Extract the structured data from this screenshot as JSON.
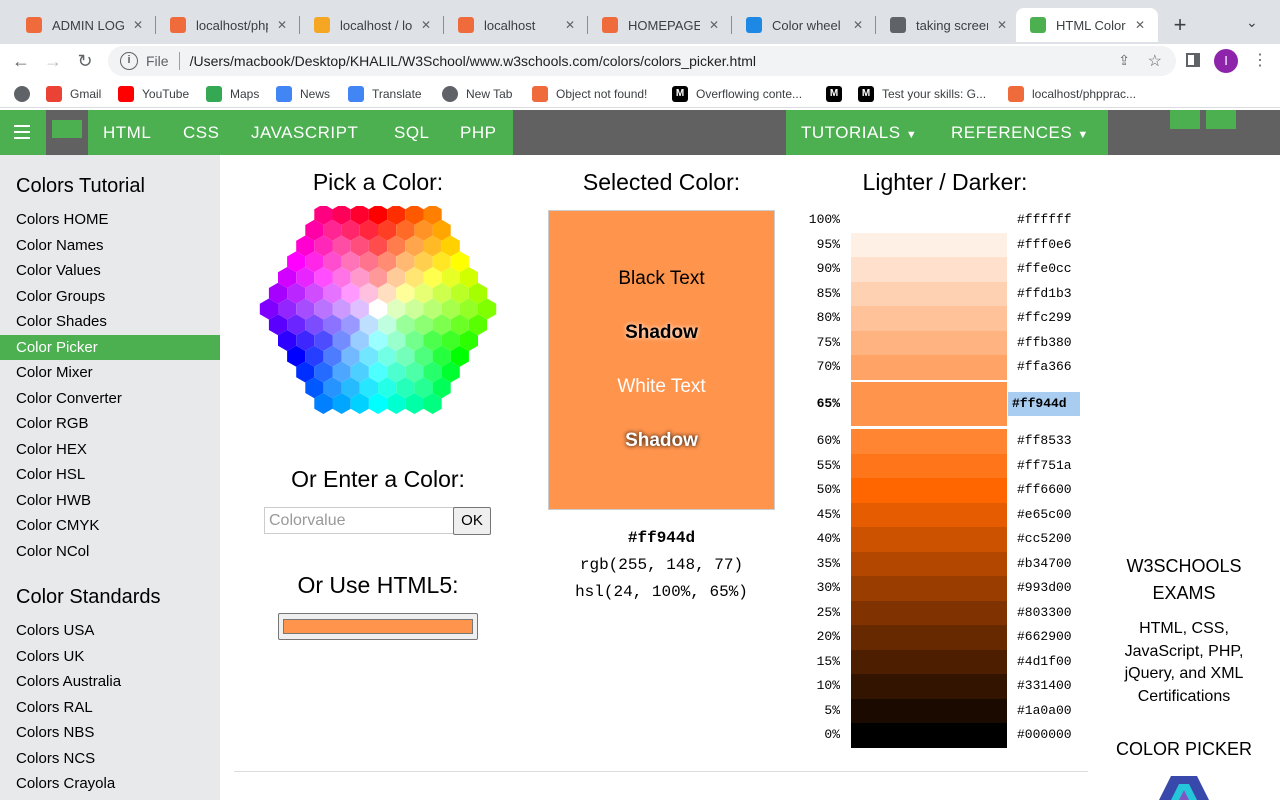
{
  "browser": {
    "tabs": [
      {
        "title": "ADMIN LOGIN",
        "icon": "xampp-icon",
        "color": "#f06b3c"
      },
      {
        "title": "localhost/phpp",
        "icon": "xampp-icon",
        "color": "#f06b3c"
      },
      {
        "title": "localhost / loc",
        "icon": "phpmyadmin-icon",
        "color": "#f5a623"
      },
      {
        "title": "localhost",
        "icon": "xampp-icon",
        "color": "#f06b3c"
      },
      {
        "title": "HOMEPAGE",
        "icon": "xampp-icon",
        "color": "#f06b3c"
      },
      {
        "title": "Color wheel -",
        "icon": "canva-icon",
        "color": "#1e88e5"
      },
      {
        "title": "taking screens",
        "icon": "globe-icon",
        "color": "#5f6368"
      },
      {
        "title": "HTML Color P",
        "icon": "w3schools-icon",
        "color": "#4caf50"
      }
    ],
    "address": {
      "scheme": "File",
      "url": "/Users/macbook/Desktop/KHALIL/W3School/www.w3schools.com/colors/colors_picker.html"
    },
    "profile_initial": "I",
    "bookmarks": [
      {
        "label": "",
        "icon": "apps-grid-icon"
      },
      {
        "label": "Gmail",
        "icon": "gmail-icon"
      },
      {
        "label": "YouTube",
        "icon": "youtube-icon"
      },
      {
        "label": "Maps",
        "icon": "maps-icon"
      },
      {
        "label": "News",
        "icon": "news-icon"
      },
      {
        "label": "Translate",
        "icon": "translate-icon"
      },
      {
        "label": "New Tab",
        "icon": "globe-icon"
      },
      {
        "label": "Object not found!",
        "icon": "xampp-icon"
      },
      {
        "label": "Overflowing conte...",
        "icon": "medium-icon"
      },
      {
        "label": "",
        "icon": "medium-icon"
      },
      {
        "label": "Test your skills: G...",
        "icon": "medium-icon"
      },
      {
        "label": "localhost/phpprac...",
        "icon": "xampp-icon"
      }
    ]
  },
  "topnav": {
    "left": [
      "HTML",
      "CSS",
      "JAVASCRIPT",
      "SQL",
      "PHP"
    ],
    "right": [
      "TUTORIALS",
      "REFERENCES"
    ]
  },
  "sidebar": {
    "heading1": "Colors Tutorial",
    "items1": [
      "Colors HOME",
      "Color Names",
      "Color Values",
      "Color Groups",
      "Color Shades",
      "Color Picker",
      "Color Mixer",
      "Color Converter",
      "Color RGB",
      "Color HEX",
      "Color HSL",
      "Color HWB",
      "Color CMYK",
      "Color NCol"
    ],
    "active": "Color Picker",
    "heading2": "Color Standards",
    "items2": [
      "Colors USA",
      "Colors UK",
      "Colors Australia",
      "Colors RAL",
      "Colors NBS",
      "Colors NCS",
      "Colors Crayola"
    ]
  },
  "main": {
    "pick_heading": "Pick a Color:",
    "enter_heading": "Or Enter a Color:",
    "input_placeholder": "Colorvalue",
    "ok_label": "OK",
    "html5_heading": "Or Use HTML5:",
    "html5_value": "#ff944d",
    "selected_heading": "Selected Color:",
    "selected_color": "#ff944d",
    "black_text": "Black Text",
    "shadow1": "Shadow",
    "white_text": "White Text",
    "shadow2": "Shadow",
    "hex": "#ff944d",
    "rgb": "rgb(255, 148, 77)",
    "hsl": "hsl(24, 100%, 65%)",
    "shades_heading": "Lighter / Darker:",
    "shades": [
      {
        "pct": "100%",
        "hex": "#ffffff"
      },
      {
        "pct": "95%",
        "hex": "#fff0e6"
      },
      {
        "pct": "90%",
        "hex": "#ffe0cc"
      },
      {
        "pct": "85%",
        "hex": "#ffd1b3"
      },
      {
        "pct": "80%",
        "hex": "#ffc299"
      },
      {
        "pct": "75%",
        "hex": "#ffb380"
      },
      {
        "pct": "70%",
        "hex": "#ffa366"
      },
      {
        "pct": "65%",
        "hex": "#ff944d",
        "selected": true
      },
      {
        "pct": "60%",
        "hex": "#ff8533"
      },
      {
        "pct": "55%",
        "hex": "#ff751a"
      },
      {
        "pct": "50%",
        "hex": "#ff6600"
      },
      {
        "pct": "45%",
        "hex": "#e65c00"
      },
      {
        "pct": "40%",
        "hex": "#cc5200"
      },
      {
        "pct": "35%",
        "hex": "#b34700"
      },
      {
        "pct": "30%",
        "hex": "#993d00"
      },
      {
        "pct": "25%",
        "hex": "#803300"
      },
      {
        "pct": "20%",
        "hex": "#662900"
      },
      {
        "pct": "15%",
        "hex": "#4d1f00"
      },
      {
        "pct": "10%",
        "hex": "#331400"
      },
      {
        "pct": "5%",
        "hex": "#1a0a00"
      },
      {
        "pct": "0%",
        "hex": "#000000"
      }
    ]
  },
  "ad": {
    "title": "W3SCHOOLS EXAMS",
    "body": "HTML, CSS, JavaScript, PHP, jQuery, and XML Certifications",
    "picker_title": "COLOR PICKER"
  }
}
